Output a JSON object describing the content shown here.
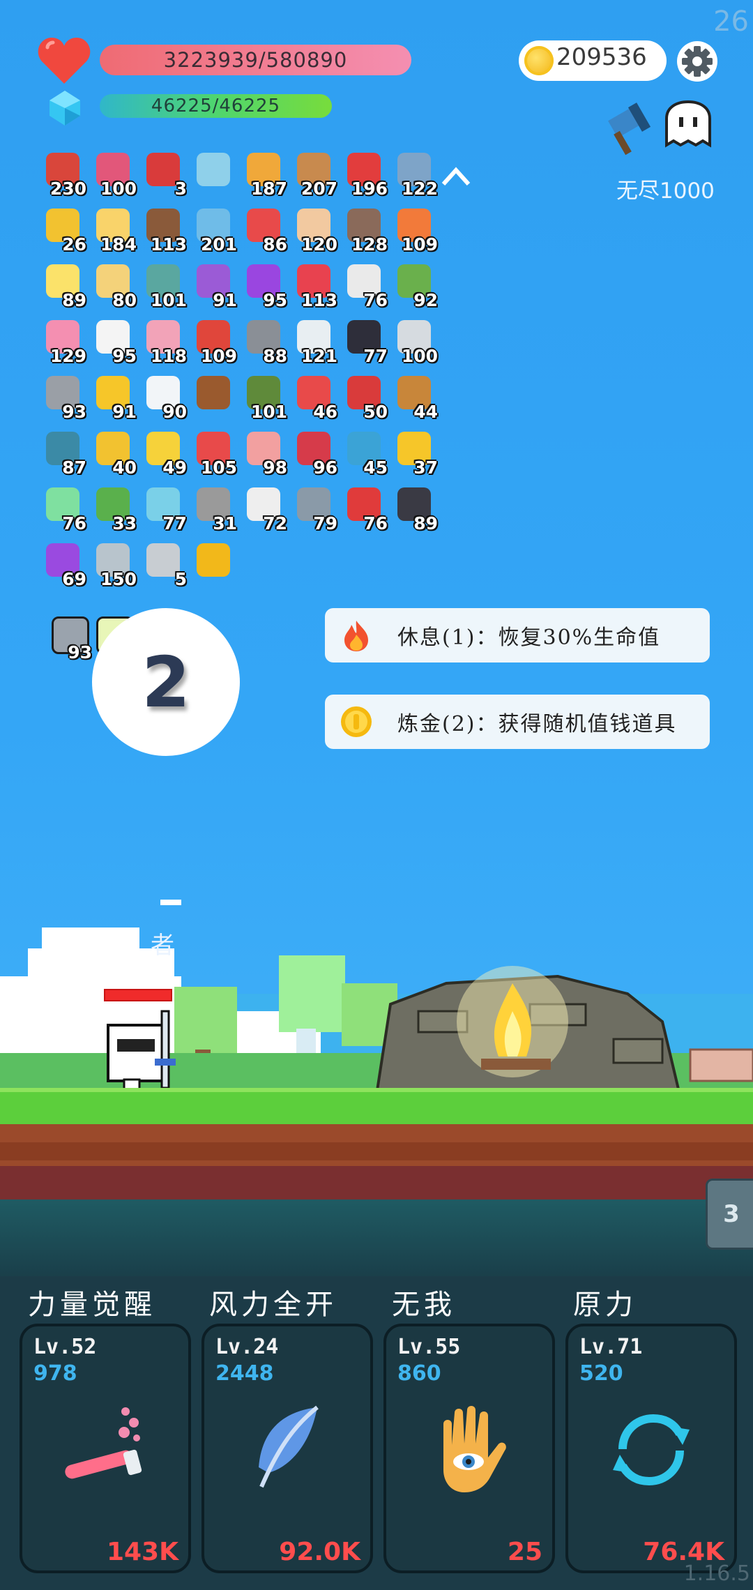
{
  "status": {
    "fps": "26",
    "hp_text": "3223939/580890",
    "hp_fraction": 1.0,
    "mp_text": "46225/46225",
    "mp_fraction": 1.0,
    "gold": "209536"
  },
  "stage": {
    "mode_label": "无尽1000"
  },
  "items": [
    {
      "icon": "boot-icon",
      "count": "230",
      "color": "#d9463b"
    },
    {
      "icon": "jar-icon",
      "count": "100",
      "color": "#e2577a"
    },
    {
      "icon": "magnet-icon",
      "count": "3",
      "color": "#d93b3b"
    },
    {
      "icon": "magnifier-icon",
      "count": "",
      "color": "#8fd0ea"
    },
    {
      "icon": "book-icon",
      "count": "187",
      "color": "#f0a83a"
    },
    {
      "icon": "donut-icon",
      "count": "207",
      "color": "#c88a4e"
    },
    {
      "icon": "apple-icon",
      "count": "196",
      "color": "#e23d3d"
    },
    {
      "icon": "shield-icon",
      "count": "122",
      "color": "#7ea4c8"
    },
    {
      "icon": "crown-icon",
      "count": "26",
      "color": "#f2c230"
    },
    {
      "icon": "flower-icon",
      "count": "184",
      "color": "#f9d36a"
    },
    {
      "icon": "coconut-icon",
      "count": "113",
      "color": "#8a5a3a"
    },
    {
      "icon": "star-card-icon",
      "count": "201",
      "color": "#6fbce8"
    },
    {
      "icon": "pill-icon",
      "count": "86",
      "color": "#e84a4a"
    },
    {
      "icon": "fist-icon",
      "count": "120",
      "color": "#f2c9a0"
    },
    {
      "icon": "grave-icon",
      "count": "128",
      "color": "#8a6a5a"
    },
    {
      "icon": "flag-icon",
      "count": "109",
      "color": "#f27a3a"
    },
    {
      "icon": "fried-egg-icon",
      "count": "89",
      "color": "#fbe26a"
    },
    {
      "icon": "note-icon",
      "count": "80",
      "color": "#f4d27a"
    },
    {
      "icon": "target-ring-icon",
      "count": "101",
      "color": "#5aa7a0"
    },
    {
      "icon": "purple-shield-icon",
      "count": "91",
      "color": "#9b5bd6"
    },
    {
      "icon": "potion-orb-icon",
      "count": "95",
      "color": "#9a46e0"
    },
    {
      "icon": "heart-icon",
      "count": "113",
      "color": "#e8424f"
    },
    {
      "icon": "cards-icon",
      "count": "76",
      "color": "#eaeaea"
    },
    {
      "icon": "zombie-icon",
      "count": "92",
      "color": "#6ab04c"
    },
    {
      "icon": "ice-cream-icon",
      "count": "129",
      "color": "#f48fb1"
    },
    {
      "icon": "ghost-icon",
      "count": "95",
      "color": "#f4f4f4"
    },
    {
      "icon": "spray-icon",
      "count": "118",
      "color": "#f2a3b8"
    },
    {
      "icon": "tomato-icon",
      "count": "109",
      "color": "#e0463b"
    },
    {
      "icon": "spike-ball-icon",
      "count": "88",
      "color": "#8a8f96"
    },
    {
      "icon": "mail-icon",
      "count": "121",
      "color": "#e8eef2"
    },
    {
      "icon": "cauldron-icon",
      "count": "77",
      "color": "#2e2e3a"
    },
    {
      "icon": "bomb-icon",
      "count": "100",
      "color": "#d6dbe0"
    },
    {
      "icon": "meteor-icon",
      "count": "93",
      "color": "#9a9fa6"
    },
    {
      "icon": "sunflower-icon",
      "count": "91",
      "color": "#f6c629"
    },
    {
      "icon": "cloud-icon",
      "count": "90",
      "color": "#f2f5f8"
    },
    {
      "icon": "chest-icon",
      "count": "",
      "color": "#9a5a2e"
    },
    {
      "icon": "grenade-icon",
      "count": "101",
      "color": "#5f8a3a"
    },
    {
      "icon": "ring-hook-icon",
      "count": "46",
      "color": "#e84a4a"
    },
    {
      "icon": "broken-heart-icon",
      "count": "50",
      "color": "#d93b3b"
    },
    {
      "icon": "bow-icon",
      "count": "44",
      "color": "#c8863a"
    },
    {
      "icon": "speech-bubble-icon",
      "count": "87",
      "color": "#3b8aa6"
    },
    {
      "icon": "gold-ring-icon",
      "count": "40",
      "color": "#f2c230"
    },
    {
      "icon": "magic-wand-icon",
      "count": "49",
      "color": "#f6d23a"
    },
    {
      "icon": "gift-icon",
      "count": "105",
      "color": "#e84a4a"
    },
    {
      "icon": "test-tube-icon",
      "count": "98",
      "color": "#f2a0a0"
    },
    {
      "icon": "red-shield-icon",
      "count": "96",
      "color": "#d63b4a"
    },
    {
      "icon": "crosshair-icon",
      "count": "45",
      "color": "#3ba3d6"
    },
    {
      "icon": "sun-cloud-icon",
      "count": "37",
      "color": "#f6c629"
    },
    {
      "icon": "alien-icon",
      "count": "76",
      "color": "#7fe0a0"
    },
    {
      "icon": "cash-heart-icon",
      "count": "33",
      "color": "#5ab04c"
    },
    {
      "icon": "scroll-icon",
      "count": "77",
      "color": "#7ad0e8"
    },
    {
      "icon": "hook-icon",
      "count": "31",
      "color": "#9a9a9a"
    },
    {
      "icon": "dice-icon",
      "count": "72",
      "color": "#eeeeee"
    },
    {
      "icon": "elephant-icon",
      "count": "79",
      "color": "#8a9aa8"
    },
    {
      "icon": "mushroom-icon",
      "count": "76",
      "color": "#e03b3b"
    },
    {
      "icon": "bat-icon",
      "count": "89",
      "color": "#3a3a44"
    },
    {
      "icon": "purple-box-icon",
      "count": "69",
      "color": "#9a4ae0"
    },
    {
      "icon": "sword-icon",
      "count": "150",
      "color": "#b8c4cc"
    },
    {
      "icon": "compass-icon",
      "count": "5",
      "color": "#c8cdd2"
    },
    {
      "icon": "coin-stack-icon",
      "count": "",
      "color": "#f2b81a"
    }
  ],
  "relics": [
    {
      "icon": "crossed-swords-icon",
      "count": "93",
      "color": "#9aa3ad"
    },
    {
      "icon": "light-frame-icon",
      "count": "",
      "color": "#e8f6b8"
    }
  ],
  "turn_counter": "2",
  "choices": [
    {
      "icon": "fire-icon",
      "label": "休息(1)：恢复30%生命值"
    },
    {
      "icon": "gold-coin-icon",
      "label": "炼金(2)：获得随机值钱道具"
    }
  ],
  "hero": {
    "name_partial": "者",
    "hp_fraction": 1.0
  },
  "side_tab": "3",
  "skills": [
    {
      "title": "力量觉醒",
      "level": "Lv.52",
      "cost": "978",
      "value": "143K",
      "icon": "potion-tube-icon"
    },
    {
      "title": "风力全开",
      "level": "Lv.24",
      "cost": "2448",
      "value": "92.0K",
      "icon": "feather-icon"
    },
    {
      "title": "无我",
      "level": "Lv.55",
      "cost": "860",
      "value": "25",
      "icon": "hamsa-eye-icon"
    },
    {
      "title": "原力",
      "level": "Lv.71",
      "cost": "520",
      "value": "76.4K",
      "icon": "cycle-arrows-icon"
    }
  ],
  "version": "1.16.5"
}
